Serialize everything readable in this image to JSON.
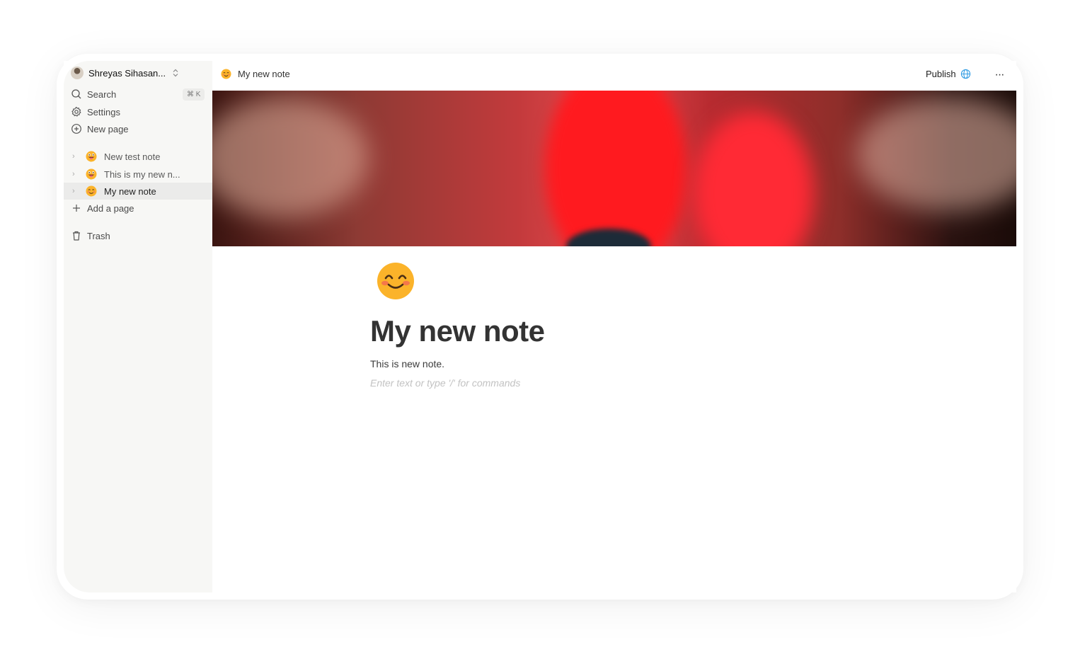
{
  "workspace": {
    "name": "Shreyas Sihasan..."
  },
  "sidebar": {
    "search_label": "Search",
    "search_shortcut": "⌘ K",
    "settings_label": "Settings",
    "new_page_label": "New page",
    "pages": [
      {
        "label": "New test note",
        "emoji": "grinning-tongue-emoji"
      },
      {
        "label": "This is my new n...",
        "emoji": "grinning-tongue-emoji"
      },
      {
        "label": "My new note",
        "emoji": "smiling-face-emoji",
        "active": true
      }
    ],
    "add_page_label": "Add a page",
    "trash_label": "Trash"
  },
  "topbar": {
    "breadcrumb": "My new note",
    "publish_label": "Publish",
    "more_label": "···"
  },
  "page": {
    "icon": "smiling-face-emoji",
    "title": "My new note",
    "body": "This is new note.",
    "placeholder": "Enter text or type '/' for commands"
  },
  "colors": {
    "sidebar_bg": "#f7f7f5",
    "active_row_bg": "#ebebea",
    "globe_icon": "#2f9be3",
    "emoji_yellow": "#fbb32a"
  }
}
